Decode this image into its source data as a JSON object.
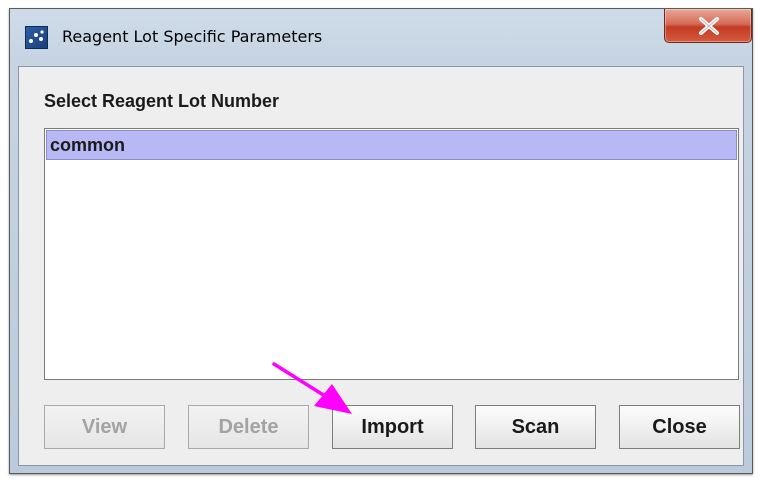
{
  "window": {
    "title": "Reagent Lot Specific Parameters",
    "close_glyph": "X"
  },
  "section": {
    "label": "Select Reagent Lot Number"
  },
  "lot_list": {
    "items": [
      {
        "label": "common",
        "selected": true
      }
    ]
  },
  "buttons": {
    "view": "View",
    "delete": "Delete",
    "import": "Import",
    "scan": "Scan",
    "close": "Close"
  },
  "icons": {
    "app": "app-icon",
    "close": "close-icon",
    "annotation": "annotation-arrow"
  },
  "colors": {
    "selection": "#b8b8f4",
    "close_button": "#c23b22",
    "annotation_arrow": "#ff00ff",
    "disabled_text": "#a3a3a3"
  }
}
